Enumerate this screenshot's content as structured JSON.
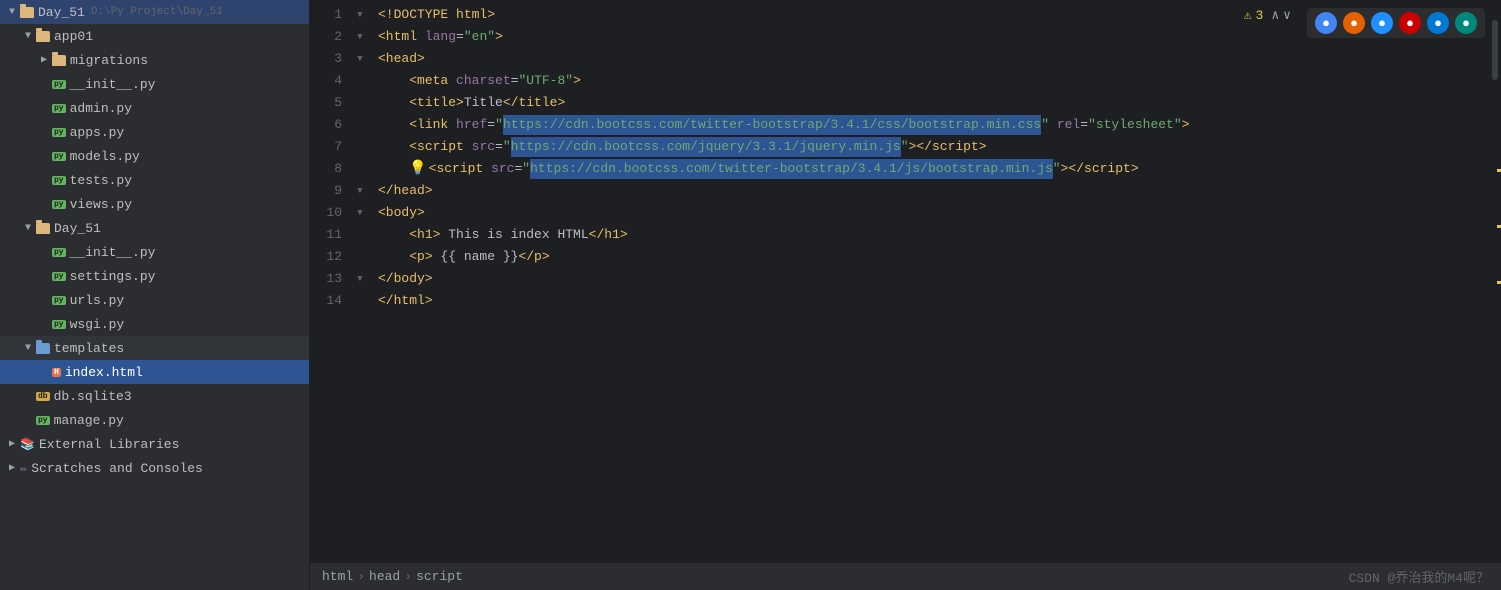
{
  "sidebar": {
    "project_root": {
      "label": "Day_51",
      "path": "D:\\Py Project\\Day_51",
      "expanded": true,
      "children": [
        {
          "label": "app01",
          "type": "folder",
          "expanded": true,
          "children": [
            {
              "label": "migrations",
              "type": "folder",
              "expanded": false
            },
            {
              "label": "__init__.py",
              "type": "python"
            },
            {
              "label": "admin.py",
              "type": "python"
            },
            {
              "label": "apps.py",
              "type": "python"
            },
            {
              "label": "models.py",
              "type": "python"
            },
            {
              "label": "tests.py",
              "type": "python"
            },
            {
              "label": "views.py",
              "type": "python"
            }
          ]
        },
        {
          "label": "Day_51",
          "type": "folder",
          "expanded": true,
          "children": [
            {
              "label": "__init__.py",
              "type": "python"
            },
            {
              "label": "settings.py",
              "type": "python"
            },
            {
              "label": "urls.py",
              "type": "python"
            },
            {
              "label": "wsgi.py",
              "type": "python"
            }
          ]
        },
        {
          "label": "templates",
          "type": "folder",
          "expanded": true,
          "selected": true,
          "children": [
            {
              "label": "index.html",
              "type": "html",
              "selected": true
            }
          ]
        },
        {
          "label": "db.sqlite3",
          "type": "db"
        },
        {
          "label": "manage.py",
          "type": "python"
        }
      ]
    },
    "external_libraries": {
      "label": "External Libraries",
      "expanded": false
    },
    "scratches": {
      "label": "Scratches and Consoles",
      "expanded": false
    }
  },
  "editor": {
    "warning_badge": "⚠ 3",
    "lines": [
      {
        "num": 1,
        "indent": "",
        "fold": true,
        "content": "<!DOCTYPE html>"
      },
      {
        "num": 2,
        "indent": "",
        "fold": true,
        "content": "<html lang=\"en\">"
      },
      {
        "num": 3,
        "indent": "",
        "fold": true,
        "content": "<head>"
      },
      {
        "num": 4,
        "indent": "    ",
        "fold": false,
        "content": "<meta charset=\"UTF-8\">"
      },
      {
        "num": 5,
        "indent": "    ",
        "fold": false,
        "content": "<title>Title</title>"
      },
      {
        "num": 6,
        "indent": "    ",
        "fold": false,
        "content": "<link href=\"https://cdn.bootcss.com/twitter-bootstrap/3.4.1/css/bootstrap.min.css\" rel=\"stylesheet\">"
      },
      {
        "num": 7,
        "indent": "    ",
        "fold": false,
        "content": "<script src=\"https://cdn.bootcss.com/jquery/3.3.1/jquery.min.js\"></script>"
      },
      {
        "num": 8,
        "indent": "    ",
        "fold": false,
        "lightbulb": true,
        "content": "<script src=\"https://cdn.bootcss.com/twitter-bootstrap/3.4.1/js/bootstrap.min.js\"></script>"
      },
      {
        "num": 9,
        "indent": "",
        "fold": true,
        "content": "</head>"
      },
      {
        "num": 10,
        "indent": "",
        "fold": true,
        "content": "<body>"
      },
      {
        "num": 11,
        "indent": "    ",
        "fold": false,
        "content": "<h1> This is index HTML</h1>"
      },
      {
        "num": 12,
        "indent": "    ",
        "fold": false,
        "content": "<p> {{ name }}</p>"
      },
      {
        "num": 13,
        "indent": "",
        "fold": true,
        "content": "</body>"
      },
      {
        "num": 14,
        "indent": "",
        "fold": false,
        "content": "</html>"
      }
    ]
  },
  "status_bar": {
    "breadcrumb": [
      "html",
      "head",
      "script"
    ],
    "watermark": "CSDN @乔治我的M4呢？"
  },
  "browser_icons": {
    "chrome": "🟢",
    "firefox": "🟠",
    "opera": "🔵",
    "opera_red": "🔴",
    "edge": "🔵",
    "edge_new": "🔵"
  }
}
